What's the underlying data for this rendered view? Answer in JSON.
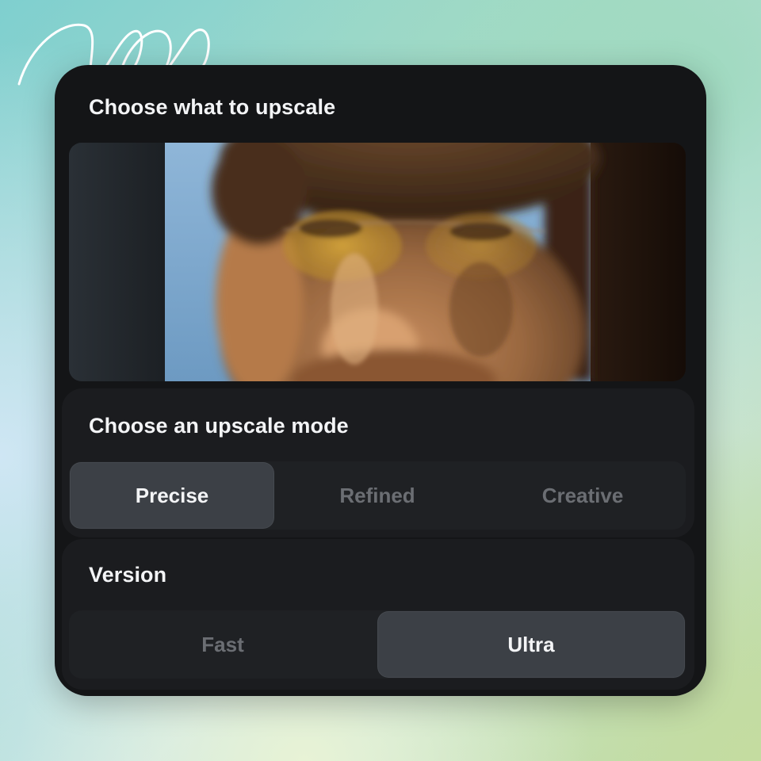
{
  "sections": {
    "upscale_target_title": "Choose what to upscale",
    "mode_title": "Choose an upscale mode",
    "version_title": "Version"
  },
  "preview": {
    "image_name": "portrait-with-yellow-glasses"
  },
  "upscale_modes": {
    "options": [
      "Precise",
      "Refined",
      "Creative"
    ],
    "selected": "Precise"
  },
  "version": {
    "options": [
      "Fast",
      "Ultra"
    ],
    "selected": "Ultra"
  },
  "colors": {
    "panel_bg": "#141517",
    "active_segment": "#3c4046",
    "active_text": "#f3f4f6",
    "inactive_text": "#6b6e73"
  }
}
